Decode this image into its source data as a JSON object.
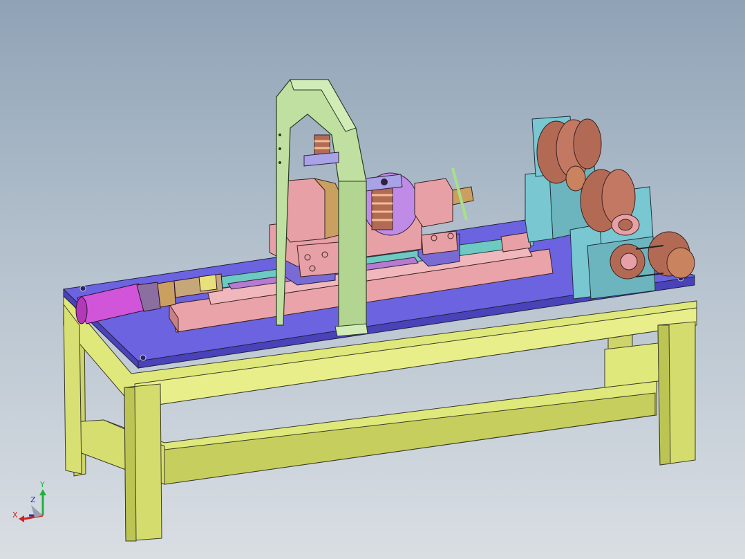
{
  "viewport": {
    "background_top": "#8fa3b6",
    "background_bottom": "#d9dee3"
  },
  "colors": {
    "frame": "#dfe87a",
    "frame_shade": "#b7c04e",
    "plate": "#6b63e0",
    "plate_side": "#4a42b8",
    "slide": "#e6a0a6",
    "arch": "#bfe0a0",
    "bearing_block": "#79c7d0",
    "coil": "#b36a55",
    "motor": "#d055d8"
  },
  "triad": {
    "x_label": "X",
    "y_label": "Y",
    "z_label": "Z"
  }
}
